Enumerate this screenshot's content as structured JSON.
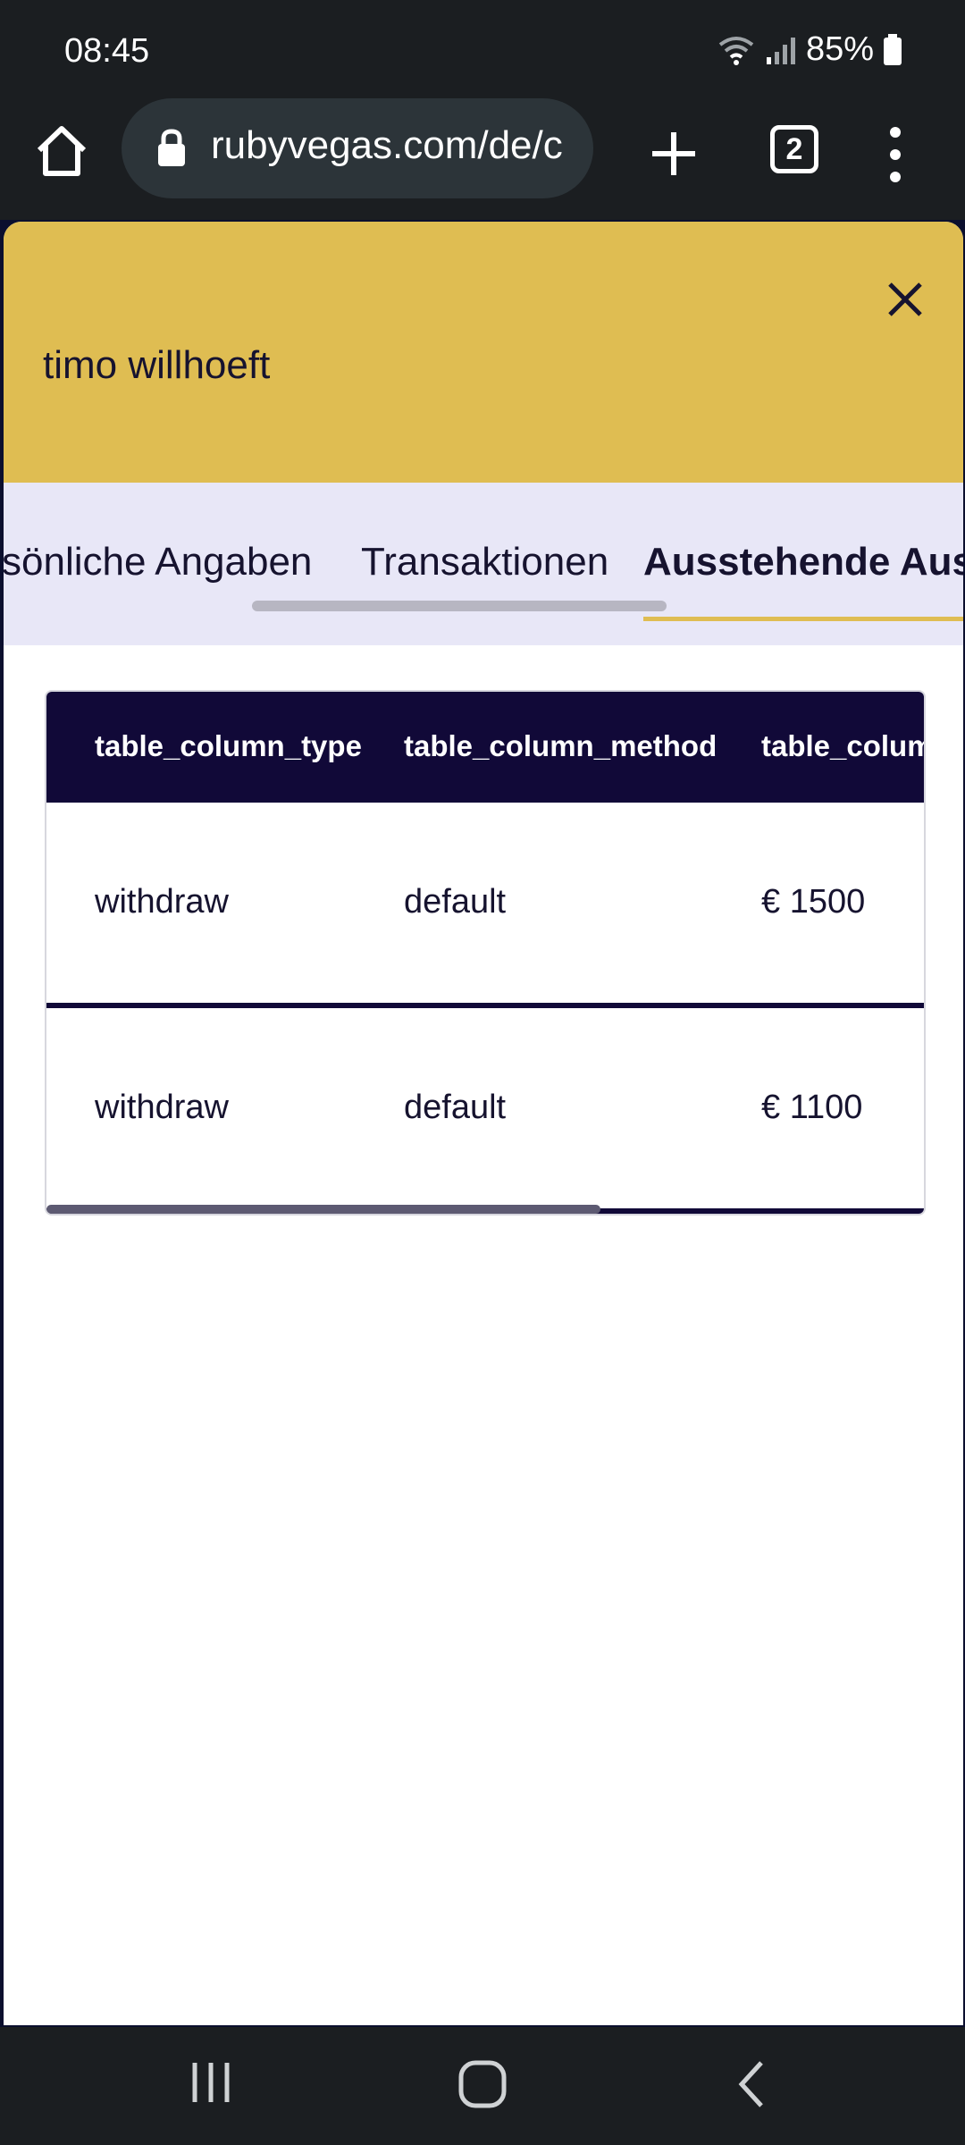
{
  "status_bar": {
    "time": "08:45",
    "battery_text": "85%",
    "icons": [
      "wifi-icon",
      "signal-icon",
      "battery-icon"
    ]
  },
  "browser": {
    "url": "rubyvegas.com/de/c",
    "tab_count": "2",
    "icons": [
      "home-icon",
      "lock-icon",
      "plus-icon",
      "tabs-icon",
      "menu-icon"
    ]
  },
  "modal": {
    "title": "timo willhoeft",
    "close_icon": "close-icon",
    "tabs": [
      {
        "label": "sönliche Angaben",
        "active": false
      },
      {
        "label": "Transaktionen",
        "active": false
      },
      {
        "label": "Ausstehende Aus:",
        "active": true
      }
    ]
  },
  "table": {
    "headers": [
      "table_column_type",
      "table_column_method",
      "table_colum"
    ],
    "rows": [
      [
        "withdraw",
        "default",
        "€ 1500"
      ],
      [
        "withdraw",
        "default",
        "€ 1100"
      ]
    ]
  },
  "chat": {
    "icon": "chat-icon"
  },
  "nav_bar": {
    "icons": [
      "recent-apps-icon",
      "home-nav-icon",
      "back-icon"
    ]
  },
  "colors": {
    "header_bg": "#dfbd52",
    "tabs_bg": "#e8e7f7",
    "table_head_bg": "#110938",
    "text_dark": "#16132f",
    "fab_bg": "#fbc30a",
    "system_bar": "#1b1e21"
  }
}
